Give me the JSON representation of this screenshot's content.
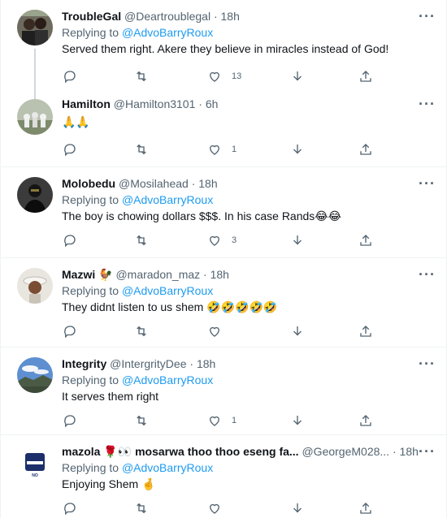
{
  "tweets": [
    {
      "name": "TroubleGal",
      "handle": "@Deartroublegal",
      "time": "18h",
      "replying_label": "Replying to",
      "replying_to": "@AdvoBarryRoux",
      "text": "Served them right. Akere they believe in miracles instead of God!",
      "likes": "13",
      "avatar": "avatar-two-people"
    },
    {
      "name": "Hamilton",
      "handle": "@Hamilton3101",
      "time": "6h",
      "replying_label": "",
      "replying_to": "",
      "text": "🙏🙏",
      "likes": "1",
      "avatar": "avatar-group-outdoors"
    },
    {
      "name": "Molobedu",
      "handle": "@Mosilahead",
      "time": "18h",
      "replying_label": "Replying to",
      "replying_to": "@AdvoBarryRoux",
      "text": "The boy is chowing dollars $$$. In his case Rands😂😂",
      "likes": "3",
      "avatar": "avatar-dark-character"
    },
    {
      "name": "Mazwi",
      "name_emoji": "🐓",
      "handle": "@maradon_maz",
      "time": "18h",
      "replying_label": "Replying to",
      "replying_to": "@AdvoBarryRoux",
      "text": "They didnt listen to us shem 🤣🤣🤣🤣🤣",
      "likes": "",
      "avatar": "avatar-person-hat"
    },
    {
      "name": "Integrity",
      "handle": "@IntergrityDee",
      "time": "18h",
      "replying_label": "Replying to",
      "replying_to": "@AdvoBarryRoux",
      "text": "It serves them right",
      "likes": "1",
      "avatar": "avatar-sky-landscape"
    },
    {
      "name": "mazola 🌹👀 mosarwa thoo thoo eseng fa...",
      "handle": "@GeorgeM028...",
      "time": "18h",
      "replying_label": "Replying to",
      "replying_to": "@AdvoBarryRoux",
      "text": "Enjoying Shem 🤞",
      "likes": "",
      "avatar": "avatar-no-sign-logo"
    }
  ],
  "dot": "·",
  "more_glyph": "···",
  "colors": {
    "link": "#1d9bf0",
    "muted": "#536471",
    "border": "#eff3f4"
  }
}
